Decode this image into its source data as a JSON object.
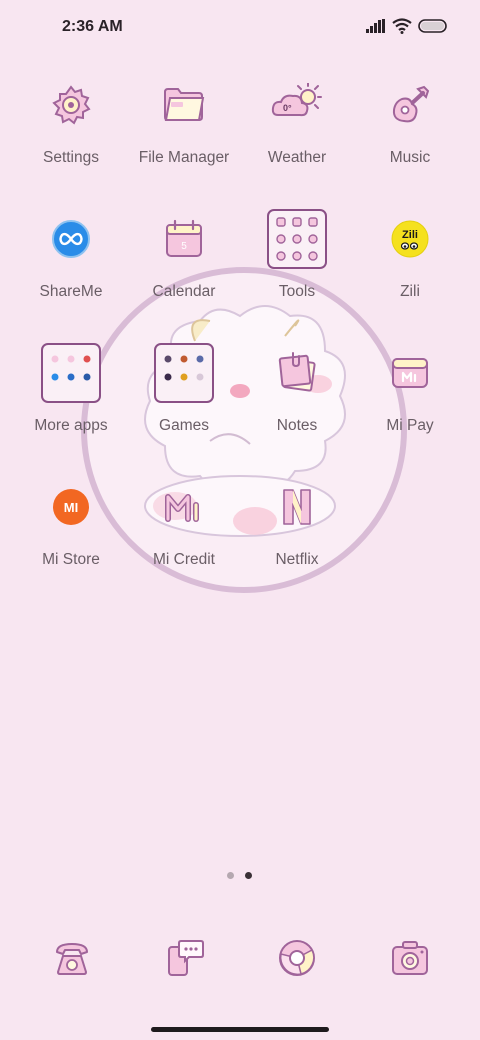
{
  "status_bar": {
    "time": "2:36 AM"
  },
  "apps": [
    {
      "label": "Settings",
      "icon": "settings-icon"
    },
    {
      "label": "File Manager",
      "icon": "folder-icon"
    },
    {
      "label": "Weather",
      "icon": "weather-icon",
      "temp": "0°"
    },
    {
      "label": "Music",
      "icon": "guitar-icon"
    },
    {
      "label": "ShareMe",
      "icon": "shareme-icon"
    },
    {
      "label": "Calendar",
      "icon": "calendar-icon",
      "day": "5"
    },
    {
      "label": "Tools",
      "icon": "tools-folder-icon"
    },
    {
      "label": "Zili",
      "icon": "zili-icon",
      "brand": "Zili"
    },
    {
      "label": "More apps",
      "icon": "more-apps-folder-icon"
    },
    {
      "label": "Games",
      "icon": "games-folder-icon"
    },
    {
      "label": "Notes",
      "icon": "notes-icon"
    },
    {
      "label": "Mi Pay",
      "icon": "mi-pay-icon"
    },
    {
      "label": "Mi Store",
      "icon": "mi-store-icon",
      "logo": "MI"
    },
    {
      "label": "Mi Credit",
      "icon": "mi-credit-icon"
    },
    {
      "label": "Netflix",
      "icon": "netflix-icon",
      "letter": "N"
    }
  ],
  "page_indicator": {
    "pages": 2,
    "current": 2
  },
  "dock": [
    {
      "icon": "phone-icon"
    },
    {
      "icon": "messages-icon"
    },
    {
      "icon": "browser-icon"
    },
    {
      "icon": "camera-icon"
    }
  ],
  "colors": {
    "background": "#f8e6f1",
    "label": "#6a5e66",
    "icon_stroke": "#a0649a",
    "icon_fill": "#f5c6de",
    "shareme_blue": "#2a8ce8",
    "zili_yellow": "#f5e11e",
    "mi_orange": "#f26722"
  }
}
